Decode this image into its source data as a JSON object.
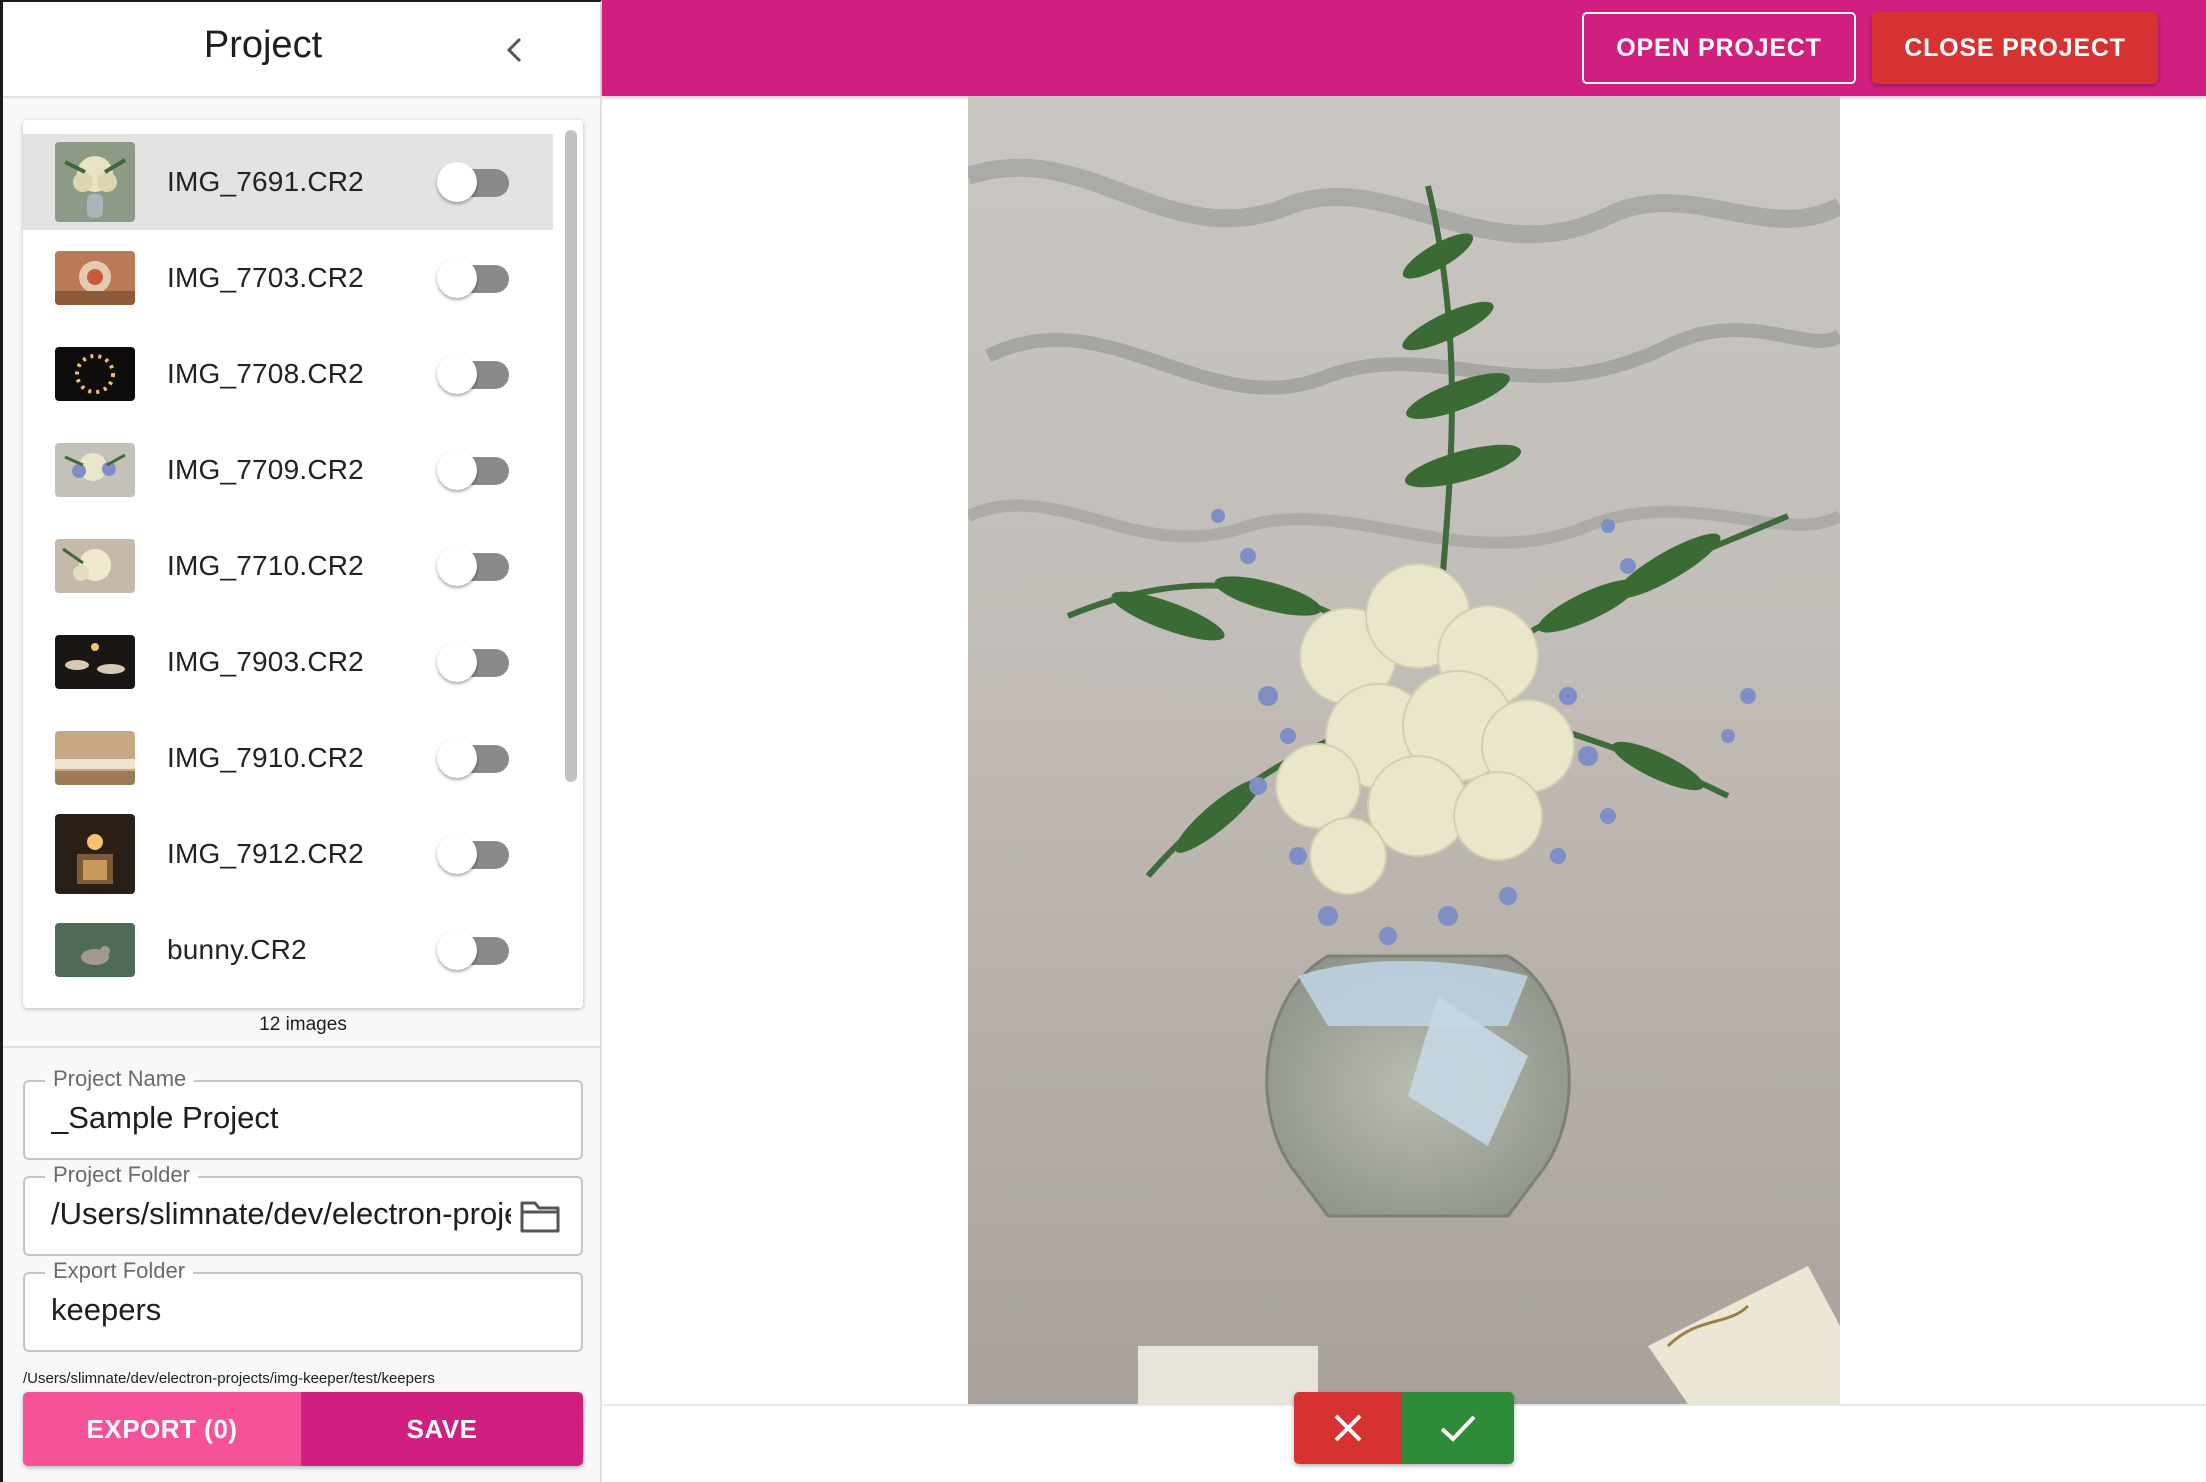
{
  "sidebar": {
    "title": "Project",
    "collapse_icon": "chevron-left-icon",
    "images": [
      {
        "name": "IMG_7691.CR2",
        "selected": true,
        "enabled": false,
        "thumb": "bouquet-vase"
      },
      {
        "name": "IMG_7703.CR2",
        "selected": false,
        "enabled": false,
        "thumb": "warm-table"
      },
      {
        "name": "IMG_7708.CR2",
        "selected": false,
        "enabled": false,
        "thumb": "light-ring"
      },
      {
        "name": "IMG_7709.CR2",
        "selected": false,
        "enabled": false,
        "thumb": "bouquet-blue"
      },
      {
        "name": "IMG_7710.CR2",
        "selected": false,
        "enabled": false,
        "thumb": "bouquet-white"
      },
      {
        "name": "IMG_7903.CR2",
        "selected": false,
        "enabled": false,
        "thumb": "dark-tables"
      },
      {
        "name": "IMG_7910.CR2",
        "selected": false,
        "enabled": false,
        "thumb": "banquet-room"
      },
      {
        "name": "IMG_7912.CR2",
        "selected": false,
        "enabled": false,
        "thumb": "chandelier"
      },
      {
        "name": "bunny.CR2",
        "selected": false,
        "enabled": false,
        "thumb": "bunny-grass"
      }
    ],
    "image_count": "12 images",
    "project_name": {
      "label": "Project Name",
      "value": "_Sample Project"
    },
    "project_folder": {
      "label": "Project Folder",
      "value": "/Users/slimnate/dev/electron-projects/img-keeper/test",
      "icon": "folder-icon"
    },
    "export_folder": {
      "label": "Export Folder",
      "value": "keepers"
    },
    "export_path": "/Users/slimnate/dev/electron-projects/img-keeper/test/keepers",
    "export_button": "EXPORT (0)",
    "save_button": "SAVE"
  },
  "topbar": {
    "open_button": "OPEN PROJECT",
    "close_button": "CLOSE PROJECT"
  },
  "preview": {
    "subject": "flower-arrangement-photo",
    "reject_icon": "close-icon",
    "accept_icon": "check-icon"
  },
  "colors": {
    "brand": "#d01f7e",
    "export_pink": "#f5529a",
    "reject_red": "#d63232",
    "accept_green": "#2e8b3a"
  }
}
